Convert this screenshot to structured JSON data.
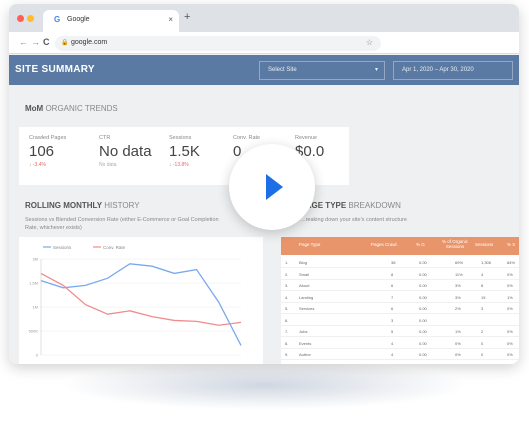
{
  "browser": {
    "tab_title": "Google",
    "tab_close": "×",
    "new_tab": "+",
    "url": "google.com",
    "back": "←",
    "forward": "→",
    "reload": "C",
    "star": "☆"
  },
  "header": {
    "title": "SITE SUMMARY",
    "select_site": "Select Site",
    "date_range": "Apr 1, 2020 – Apr 30, 2020",
    "caret": "▾"
  },
  "trends": {
    "title_bold": "MoM",
    "title_rest": " ORGANIC TRENDS",
    "kpis": [
      {
        "label": "Crawled Pages",
        "value": "106",
        "change": "↓ -3.4%"
      },
      {
        "label": "CTR",
        "value": "No data",
        "change": "No data"
      },
      {
        "label": "Sessions",
        "value": "1.5K",
        "change": "↓ -13.8%"
      },
      {
        "label": "Conv. Rate",
        "value": "0",
        "change": ""
      },
      {
        "label": "Revenue",
        "value": "$0.0",
        "change": "-0%"
      }
    ]
  },
  "rolling": {
    "title_bold": "ROLLING MONTHLY",
    "title_rest": " HISTORY",
    "subtitle": "Sessions vs Blended Conversion Rate (either E-Commerce or Goal Completion Rate, whichever exists)"
  },
  "pagetype": {
    "title_bold": "PAGE TYPE",
    "title_rest": " BREAKDOWN",
    "subtitle": "...reaking down your site's content structure"
  },
  "chart_data": {
    "type": "line",
    "legend": [
      "Sessions",
      "Conv. Rate"
    ],
    "x": [
      1,
      2,
      3,
      4,
      5,
      6,
      7,
      8,
      9,
      10
    ],
    "series": [
      {
        "name": "Sessions",
        "color": "#7aa8f0",
        "values": [
          1.55,
          1.4,
          1.45,
          1.6,
          1.9,
          1.85,
          1.7,
          1.78,
          1.1,
          0.2
        ]
      },
      {
        "name": "Conv. Rate",
        "color": "#f08c8c",
        "values": [
          1.7,
          1.45,
          1.05,
          0.85,
          0.92,
          0.8,
          0.72,
          0.7,
          0.62,
          0.68
        ]
      }
    ],
    "ylim": [
      0,
      2
    ],
    "y_ticks": [
      "2M",
      "1.5M",
      "1M",
      "500K",
      "0"
    ]
  },
  "table": {
    "headers": [
      "Page Type",
      "Pages Crawl.",
      "% G",
      "% of Organic Sessions",
      "Sessions",
      "% S"
    ],
    "rows": [
      {
        "n": "1.",
        "type": "Blog",
        "pages": "38",
        "g": "0.00",
        "pct": "69%",
        "sess": "1,306",
        "s": "84%"
      },
      {
        "n": "2.",
        "type": "Small",
        "pages": "8",
        "g": "0.00",
        "pct": "11%",
        "sess": "4",
        "s": "0%"
      },
      {
        "n": "3.",
        "type": "About",
        "pages": "6",
        "g": "0.00",
        "pct": "3%",
        "sess": "8",
        "s": "0%"
      },
      {
        "n": "4.",
        "type": "Landing",
        "pages": "7",
        "g": "0.00",
        "pct": "3%",
        "sess": "15",
        "s": "1%"
      },
      {
        "n": "5.",
        "type": "Services",
        "pages": "6",
        "g": "0.00",
        "pct": "2%",
        "sess": "3",
        "s": "0%"
      },
      {
        "n": "6.",
        "type": "",
        "pages": "3",
        "g": "0.00",
        "pct": "",
        "sess": "",
        "s": ""
      },
      {
        "n": "7.",
        "type": "Jobs",
        "pages": "5",
        "g": "0.00",
        "pct": "1%",
        "sess": "2",
        "s": "0%"
      },
      {
        "n": "8.",
        "type": "Events",
        "pages": "4",
        "g": "0.00",
        "pct": "0%",
        "sess": "0",
        "s": "0%"
      },
      {
        "n": "9.",
        "type": "Author",
        "pages": "4",
        "g": "0.00",
        "pct": "0%",
        "sess": "0",
        "s": "0%"
      }
    ]
  },
  "colors": {
    "header": "#5b7aa3",
    "table_header": "#e8956c",
    "play": "#1d6fe8"
  }
}
